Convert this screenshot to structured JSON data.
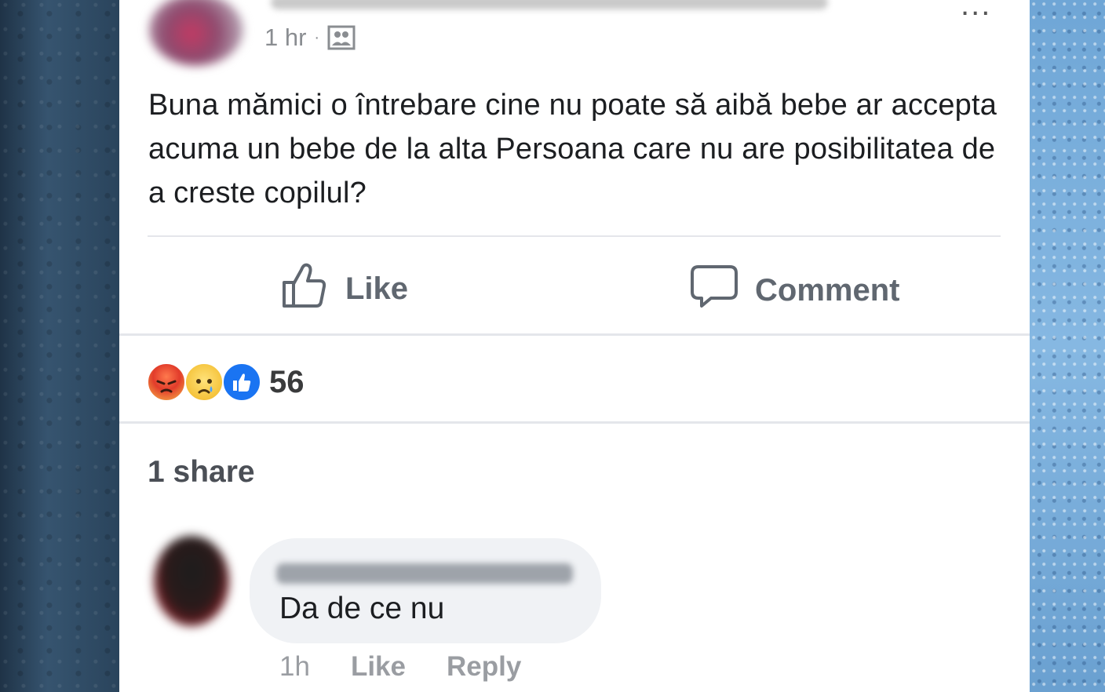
{
  "post": {
    "time": "1 hr",
    "separator": "·",
    "audience_icon": "friends-icon",
    "more_icon": "...",
    "text": "Buna mămici o întrebare cine nu poate să aibă bebe ar accepta acuma un bebe de la alta Persoana care nu are posibilitatea de a creste copilul?"
  },
  "actions": {
    "like_label": "Like",
    "comment_label": "Comment"
  },
  "reactions": {
    "icons": [
      "angry-emoji",
      "sad-emoji",
      "like-emoji"
    ],
    "count": "56"
  },
  "shares": "1 share",
  "comment": {
    "text": "Da de ce nu",
    "time": "1h",
    "like_label": "Like",
    "reply_label": "Reply"
  },
  "colors": {
    "text": "#1c1e21",
    "muted": "#606770",
    "bubble": "#f0f2f5",
    "like_blue": "#1a74f2"
  }
}
